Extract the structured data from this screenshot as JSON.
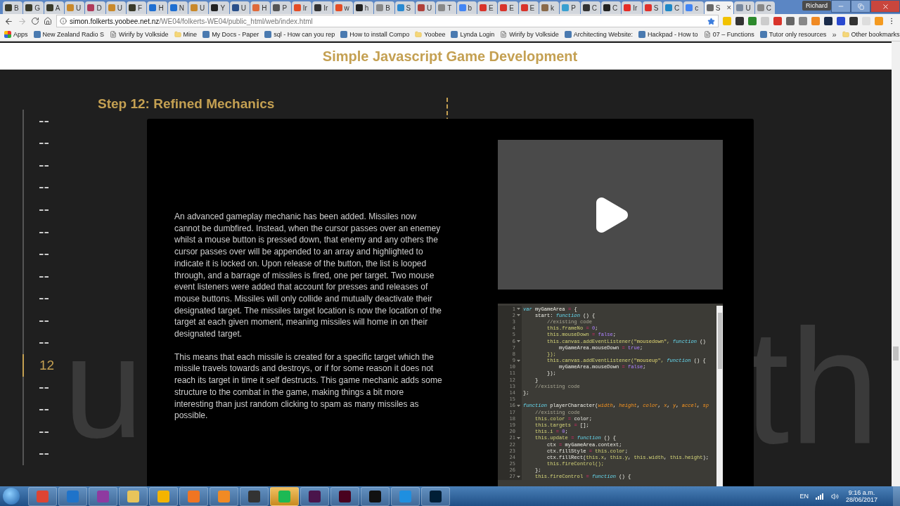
{
  "browser": {
    "tabs": [
      {
        "label": "B",
        "color": "#3a3a2a",
        "selected": false
      },
      {
        "label": "G",
        "color": "#3a3a2a",
        "selected": false
      },
      {
        "label": "A",
        "color": "#3a3a2a",
        "selected": false
      },
      {
        "label": "U",
        "color": "#c9892b",
        "selected": false
      },
      {
        "label": "D",
        "color": "#b03a5a",
        "selected": false
      },
      {
        "label": "U",
        "color": "#c9892b",
        "selected": false
      },
      {
        "label": "F",
        "color": "#3a3a2a",
        "selected": false
      },
      {
        "label": "H",
        "color": "#1f6fd1",
        "selected": false
      },
      {
        "label": "N",
        "color": "#1f6fd1",
        "selected": false
      },
      {
        "label": "U",
        "color": "#c9892b",
        "selected": false
      },
      {
        "label": "Y",
        "color": "#222222",
        "selected": false
      },
      {
        "label": "U",
        "color": "#2a4f8a",
        "selected": false
      },
      {
        "label": "H",
        "color": "#e06a3a",
        "selected": false
      },
      {
        "label": "P",
        "color": "#555555",
        "selected": false
      },
      {
        "label": "Ir",
        "color": "#e44d26",
        "selected": false
      },
      {
        "label": "Ir",
        "color": "#333333",
        "selected": false
      },
      {
        "label": "w",
        "color": "#e44d26",
        "selected": false
      },
      {
        "label": "h",
        "color": "#222222",
        "selected": false
      },
      {
        "label": "B",
        "color": "#888888",
        "selected": false
      },
      {
        "label": "S",
        "color": "#2a8ad1",
        "selected": false
      },
      {
        "label": "U",
        "color": "#b0403a",
        "selected": false
      },
      {
        "label": "T",
        "color": "#888888",
        "selected": false
      },
      {
        "label": "b",
        "color": "#4285f4",
        "selected": false
      },
      {
        "label": "E",
        "color": "#d9342b",
        "selected": false
      },
      {
        "label": "E",
        "color": "#d9342b",
        "selected": false
      },
      {
        "label": "E",
        "color": "#d9342b",
        "selected": false
      },
      {
        "label": "k",
        "color": "#8a6a4a",
        "selected": false
      },
      {
        "label": "P",
        "color": "#3aa0d0",
        "selected": false
      },
      {
        "label": "C",
        "color": "#333333",
        "selected": false
      },
      {
        "label": "C",
        "color": "#222222",
        "selected": false
      },
      {
        "label": "Ir",
        "color": "#e52d27",
        "selected": false
      },
      {
        "label": "S",
        "color": "#e0302a",
        "selected": false
      },
      {
        "label": "C",
        "color": "#1e88c7",
        "selected": false
      },
      {
        "label": "c",
        "color": "#4285f4",
        "selected": false
      },
      {
        "label": "S",
        "color": "#6a6a6a",
        "selected": true
      },
      {
        "label": "U",
        "color": "#7a8aa0",
        "selected": false
      },
      {
        "label": "C",
        "color": "#888888",
        "selected": false
      }
    ],
    "tab_close": "✕",
    "profile": "Richard",
    "url": {
      "host": "simon.folkerts.yoobee.net.nz",
      "path": "/WE04/folkerts-WE04/public_html/web/index.html"
    },
    "bookmarks": [
      {
        "label": "Apps",
        "kind": "apps"
      },
      {
        "label": "New Zealand Radio S",
        "kind": "site"
      },
      {
        "label": "Wirify by Volkside",
        "kind": "page"
      },
      {
        "label": "Mine",
        "kind": "folder"
      },
      {
        "label": "My Docs - Paper",
        "kind": "site"
      },
      {
        "label": "sql - How can you rep",
        "kind": "site"
      },
      {
        "label": "How to install Compo",
        "kind": "site"
      },
      {
        "label": "Yoobee",
        "kind": "folder"
      },
      {
        "label": "Lynda Login",
        "kind": "site"
      },
      {
        "label": "Wirify by Volkside",
        "kind": "page"
      },
      {
        "label": "Architecting Website:",
        "kind": "site"
      },
      {
        "label": "Hackpad - How to",
        "kind": "site"
      },
      {
        "label": "07 – Functions",
        "kind": "page"
      },
      {
        "label": "Tutor only resources",
        "kind": "site"
      }
    ],
    "bookmarks_more": "»",
    "other_bookmarks": "Other bookmarks"
  },
  "page": {
    "header_title": "Simple Javascript Game Development",
    "background_words": [
      "u",
      "th"
    ],
    "timeline": [
      {
        "selected": false
      },
      {
        "selected": false
      },
      {
        "selected": false
      },
      {
        "selected": false
      },
      {
        "selected": false
      },
      {
        "selected": false
      },
      {
        "selected": false
      },
      {
        "selected": false
      },
      {
        "selected": false
      },
      {
        "selected": false
      },
      {
        "selected": false
      },
      {
        "selected": true,
        "label": "12"
      },
      {
        "selected": false
      },
      {
        "selected": false
      },
      {
        "selected": false
      },
      {
        "selected": false
      }
    ],
    "step_title": "Step 12: Refined Mechanics",
    "paragraphs": [
      "An advanced gameplay mechanic has been added. Missiles now cannot be dumbfired. Instead, when the cursor passes over an enemey whilst a mouse button is pressed down, that enemy and any others the cursor passes over will be appended to an array and highlighted to indicate it is locked on. Upon release of the button, the list is looped through, and a barrage of missiles is fired, one per target. Two mouse event listeners were added that account for presses and releases of mouse buttons. Missiles will only collide and mutually deactivate their designated target. The missiles target location is now the location of the target at each given moment, meaning missiles will home in on their designated target.",
      "This means that each missile is created for a specific target which the missile travels towards and destroys, or if for some reason it does not reach its target in time it self destructs. This game mechanic adds some structure to the combat in the game, making things a bit more interesting than just random clicking to spam as many missiles as possible."
    ],
    "code": [
      {
        "n": "1",
        "fold": true,
        "segs": [
          {
            "kind": "keyword",
            "text": "var"
          },
          {
            "kind": "plain",
            "text": " myGameArea "
          },
          {
            "kind": "operator",
            "text": "="
          },
          {
            "kind": "plain",
            "text": " {"
          }
        ]
      },
      {
        "n": "2",
        "fold": true,
        "segs": [
          {
            "kind": "plain",
            "text": "    start: "
          },
          {
            "kind": "keyword",
            "text": "function"
          },
          {
            "kind": "plain",
            "text": " () {"
          }
        ]
      },
      {
        "n": "3",
        "fold": false,
        "segs": [
          {
            "kind": "comment",
            "text": "        //existing code"
          }
        ]
      },
      {
        "n": "4",
        "fold": false,
        "segs": [
          {
            "kind": "this",
            "text": "        this.frameNo "
          },
          {
            "kind": "operator",
            "text": "="
          },
          {
            "kind": "number",
            "text": " 0"
          },
          {
            "kind": "plain",
            "text": ";"
          }
        ]
      },
      {
        "n": "5",
        "fold": false,
        "segs": [
          {
            "kind": "this",
            "text": "        this.mouseDown "
          },
          {
            "kind": "operator",
            "text": "="
          },
          {
            "kind": "number",
            "text": " false"
          },
          {
            "kind": "plain",
            "text": ";"
          }
        ]
      },
      {
        "n": "6",
        "fold": true,
        "segs": [
          {
            "kind": "this",
            "text": "        this.canvas.addEventListener("
          },
          {
            "kind": "string",
            "text": "\"mousedown\""
          },
          {
            "kind": "this",
            "text": ", "
          },
          {
            "kind": "keyword",
            "text": "function"
          },
          {
            "kind": "plain",
            "text": " ()"
          }
        ]
      },
      {
        "n": "7",
        "fold": false,
        "segs": [
          {
            "kind": "plain",
            "text": "            myGameArea.mouseDown "
          },
          {
            "kind": "operator",
            "text": "="
          },
          {
            "kind": "number",
            "text": " true"
          },
          {
            "kind": "plain",
            "text": ";"
          }
        ]
      },
      {
        "n": "8",
        "fold": false,
        "segs": [
          {
            "kind": "this",
            "text": "        });"
          }
        ]
      },
      {
        "n": "9",
        "fold": true,
        "segs": [
          {
            "kind": "this",
            "text": "        this.canvas.addEventListener("
          },
          {
            "kind": "string",
            "text": "\"mouseup\""
          },
          {
            "kind": "this",
            "text": ", "
          },
          {
            "kind": "keyword",
            "text": "function"
          },
          {
            "kind": "plain",
            "text": " () {"
          }
        ]
      },
      {
        "n": "10",
        "fold": false,
        "segs": [
          {
            "kind": "plain",
            "text": "            myGameArea.mouseDown "
          },
          {
            "kind": "operator",
            "text": "="
          },
          {
            "kind": "number",
            "text": " false"
          },
          {
            "kind": "plain",
            "text": ";"
          }
        ]
      },
      {
        "n": "11",
        "fold": false,
        "segs": [
          {
            "kind": "plain",
            "text": "        });"
          }
        ]
      },
      {
        "n": "12",
        "fold": false,
        "segs": [
          {
            "kind": "plain",
            "text": "    }"
          }
        ]
      },
      {
        "n": "13",
        "fold": false,
        "segs": [
          {
            "kind": "comment",
            "text": "    //existing code"
          }
        ]
      },
      {
        "n": "14",
        "fold": false,
        "segs": [
          {
            "kind": "plain",
            "text": "};"
          }
        ]
      },
      {
        "n": "15",
        "fold": false
      },
      {
        "n": "16",
        "fold": true,
        "segs": [
          {
            "kind": "keyword",
            "text": "function"
          },
          {
            "kind": "plain",
            "text": " playerCharacter("
          },
          {
            "kind": "param",
            "text": "width"
          },
          {
            "kind": "plain",
            "text": ", "
          },
          {
            "kind": "param",
            "text": "height"
          },
          {
            "kind": "plain",
            "text": ", "
          },
          {
            "kind": "param",
            "text": "color"
          },
          {
            "kind": "plain",
            "text": ", "
          },
          {
            "kind": "param",
            "text": "x"
          },
          {
            "kind": "plain",
            "text": ", "
          },
          {
            "kind": "param",
            "text": "y"
          },
          {
            "kind": "plain",
            "text": ", "
          },
          {
            "kind": "param",
            "text": "accel"
          },
          {
            "kind": "plain",
            "text": ", "
          },
          {
            "kind": "param",
            "text": "sp"
          }
        ]
      },
      {
        "n": "17",
        "fold": false,
        "segs": [
          {
            "kind": "comment",
            "text": "    //existing code"
          }
        ]
      },
      {
        "n": "18",
        "fold": false,
        "segs": [
          {
            "kind": "this",
            "text": "    this.color "
          },
          {
            "kind": "operator",
            "text": "="
          },
          {
            "kind": "plain",
            "text": " color;"
          }
        ]
      },
      {
        "n": "19",
        "fold": false,
        "segs": [
          {
            "kind": "this",
            "text": "    this.targets "
          },
          {
            "kind": "operator",
            "text": "="
          },
          {
            "kind": "plain",
            "text": " [];"
          }
        ]
      },
      {
        "n": "20",
        "fold": false,
        "segs": [
          {
            "kind": "this",
            "text": "    this.i "
          },
          {
            "kind": "operator",
            "text": "="
          },
          {
            "kind": "number",
            "text": " 0"
          },
          {
            "kind": "plain",
            "text": ";"
          }
        ]
      },
      {
        "n": "21",
        "fold": true,
        "segs": [
          {
            "kind": "this",
            "text": "    this.update "
          },
          {
            "kind": "operator",
            "text": "="
          },
          {
            "kind": "keyword",
            "text": " function"
          },
          {
            "kind": "plain",
            "text": " () {"
          }
        ]
      },
      {
        "n": "22",
        "fold": false,
        "segs": [
          {
            "kind": "plain",
            "text": "        ctx "
          },
          {
            "kind": "operator",
            "text": "="
          },
          {
            "kind": "plain",
            "text": " myGameArea.context;"
          }
        ]
      },
      {
        "n": "23",
        "fold": false,
        "segs": [
          {
            "kind": "plain",
            "text": "        ctx.fillStyle "
          },
          {
            "kind": "operator",
            "text": "="
          },
          {
            "kind": "this",
            "text": " this.color"
          },
          {
            "kind": "plain",
            "text": ";"
          }
        ]
      },
      {
        "n": "24",
        "fold": false,
        "segs": [
          {
            "kind": "plain",
            "text": "        ctx.fillRect("
          },
          {
            "kind": "this",
            "text": "this.x"
          },
          {
            "kind": "plain",
            "text": ", "
          },
          {
            "kind": "this",
            "text": "this.y"
          },
          {
            "kind": "plain",
            "text": ", "
          },
          {
            "kind": "this",
            "text": "this.width"
          },
          {
            "kind": "plain",
            "text": ", "
          },
          {
            "kind": "this",
            "text": "this.height"
          },
          {
            "kind": "plain",
            "text": ");"
          }
        ]
      },
      {
        "n": "25",
        "fold": false,
        "segs": [
          {
            "kind": "this",
            "text": "        this.fireControl();"
          }
        ]
      },
      {
        "n": "26",
        "fold": false,
        "segs": [
          {
            "kind": "plain",
            "text": "    };"
          }
        ]
      },
      {
        "n": "27",
        "fold": true,
        "segs": [
          {
            "kind": "this",
            "text": "    this.fireControl "
          },
          {
            "kind": "operator",
            "text": "="
          },
          {
            "kind": "keyword",
            "text": " function"
          },
          {
            "kind": "plain",
            "text": " () {"
          }
        ]
      }
    ]
  },
  "taskbar": {
    "apps": [
      {
        "selected": false
      },
      {
        "selected": false
      },
      {
        "selected": false
      },
      {
        "selected": false
      },
      {
        "selected": false
      },
      {
        "selected": false
      },
      {
        "selected": false
      },
      {
        "selected": false
      },
      {
        "selected": true
      },
      {
        "selected": false
      },
      {
        "selected": false
      },
      {
        "selected": false
      },
      {
        "selected": false
      },
      {
        "selected": false
      }
    ],
    "language": "EN",
    "time": "9:16 a.m.",
    "date": "28/06/2017"
  }
}
